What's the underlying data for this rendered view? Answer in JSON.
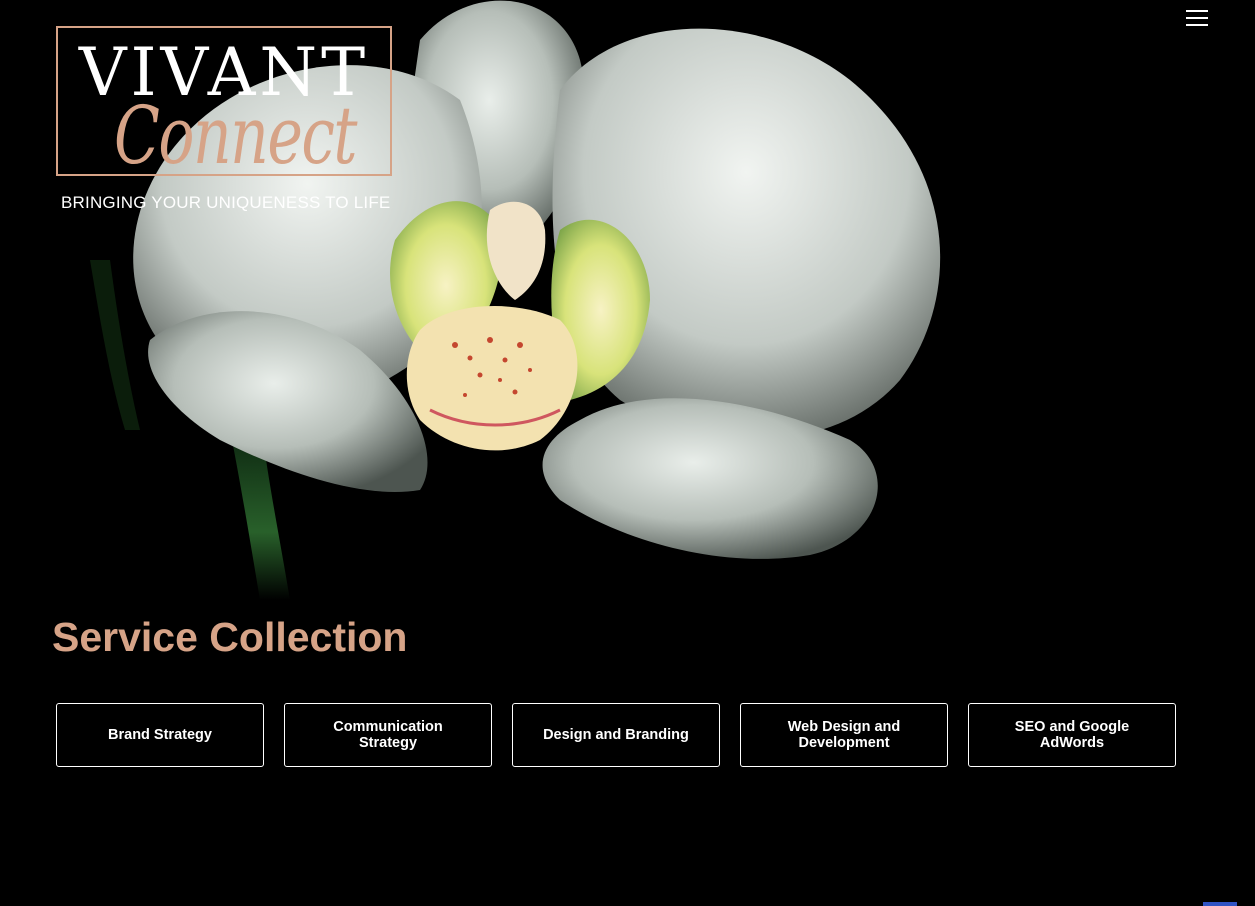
{
  "brand": {
    "name_top": "VIVANT",
    "name_script": "Connect",
    "tagline": "BRINGING YOUR UNIQUENESS TO LIFE",
    "accent_color": "#d6a387"
  },
  "header": {
    "menu_icon": "hamburger-menu-icon"
  },
  "hero": {
    "image": "white-orchid-photo"
  },
  "services": {
    "title": "Service Collection",
    "items": [
      {
        "label": "Brand Strategy"
      },
      {
        "label": "Communication Strategy"
      },
      {
        "label": "Design and Branding"
      },
      {
        "label": "Web Design and Development"
      },
      {
        "label": "SEO and Google AdWords"
      }
    ]
  }
}
